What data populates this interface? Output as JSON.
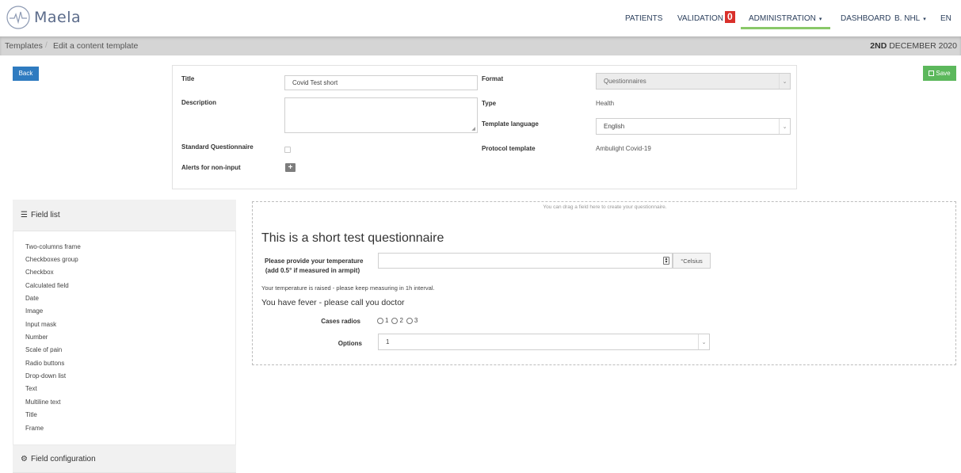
{
  "brand": {
    "logo_text": "Maela",
    "logo_icon": "heartbeat-circle-logo"
  },
  "nav": {
    "patients": "PATIENTS",
    "validation": "VALIDATION",
    "validation_count": "0",
    "administration": "ADMINISTRATION",
    "dashboard": "DASHBOARD",
    "user": "B. NHL",
    "language": "EN",
    "caret": "▾",
    "active_color": "#89c868"
  },
  "breadcrumb": {
    "templates": "Templates",
    "separator": "/",
    "current": "Edit a content template",
    "date_bold": "2ND",
    "date_rest": "DECEMBER 2020"
  },
  "actions": {
    "back": "Back",
    "save": "Save",
    "save_icon": "floppy-disk-icon"
  },
  "form": {
    "title_label": "Title",
    "title_value": "Covid Test short",
    "description_label": "Description",
    "description_value": "",
    "standard_label": "Standard Questionnaire",
    "standard_checked": false,
    "alerts_label": "Alerts for non-input",
    "alerts_button": "+",
    "format_label": "Format",
    "format_value": "Questionnaires",
    "type_label": "Type",
    "type_value": "Health",
    "language_label": "Template language",
    "language_value": "English",
    "protocol_label": "Protocol template",
    "protocol_value": "Ambulight Covid-19"
  },
  "field_list": {
    "header": "Field list",
    "header_icon": "list-icon",
    "items": [
      "Two-columns frame",
      "Checkboxes group",
      "Checkbox",
      "Calculated field",
      "Date",
      "Image",
      "Input mask",
      "Number",
      "Scale of pain",
      "Radio buttons",
      "Drop-down list",
      "Text",
      "Multiline text",
      "Title",
      "Frame"
    ],
    "config_header": "Field configuration",
    "config_icon": "gears-icon"
  },
  "questionnaire": {
    "drop_hint": "You can drag a field here to create your questionnaire.",
    "title": "This is a short test questionnaire",
    "temp_label_line1": "Please provide your temperature",
    "temp_label_line2": "(add 0.5° if measured in armpit)",
    "temp_value": "",
    "temp_unit": "°Celsius",
    "raised_note": "Your temperature is raised - please keep measuring in 1h interval.",
    "fever_note": "You have fever - please call you doctor",
    "radios_label": "Cases radios",
    "radio_options": [
      "1",
      "2",
      "3"
    ],
    "options_label": "Options",
    "options_value": "1"
  }
}
